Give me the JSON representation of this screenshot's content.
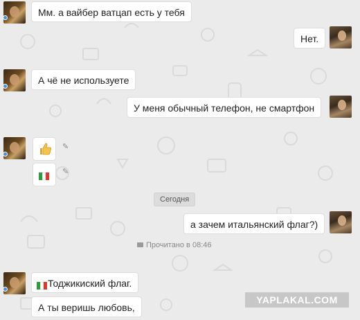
{
  "chat": {
    "messages": [
      {
        "text": "Мм. а вайбер ватцап есть у тебя"
      },
      {
        "text": "Нет."
      },
      {
        "text": "А чё не используете"
      },
      {
        "text": "У меня обычный телефон, не смартфон"
      },
      {
        "sticker": "thumbs-up-emoji"
      },
      {
        "sticker": "italy-flag-emoji"
      },
      {
        "text": "а зачем итальянский флаг?)"
      },
      {
        "text": "Тоджикиский флаг."
      },
      {
        "text": "А ты веришь любовь,"
      }
    ],
    "date_divider": "Сегодня",
    "read_status": "Прочитано в 08:46"
  },
  "watermark": "YAPLAKAL.COM",
  "colors": {
    "background": "#ebebeb",
    "bubble": "#ffffff",
    "online": "#4a90d9",
    "watermark_bg": "#c7c7c7"
  }
}
